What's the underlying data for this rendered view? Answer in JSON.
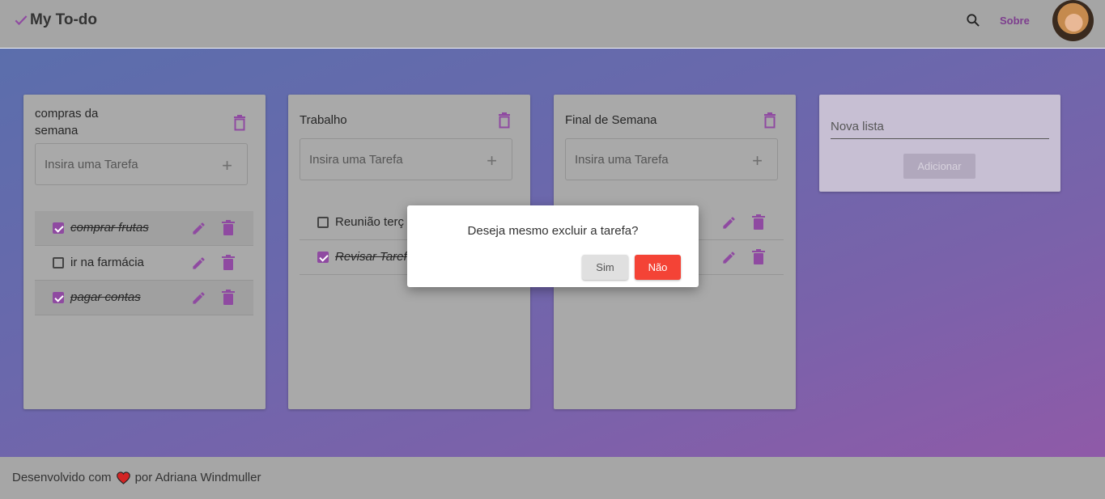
{
  "header": {
    "title": "My To-do",
    "search_icon": "search-icon",
    "sobre_label": "Sobre",
    "check_color": "#8f4aa1"
  },
  "lists": [
    {
      "title_line1": "compras da",
      "title_line2": "semana",
      "input_placeholder": "Insira uma Tarefa",
      "tasks": [
        {
          "label": "comprar frutas",
          "done": true
        },
        {
          "label": "ir na farmácia",
          "done": false
        },
        {
          "label": "pagar contas",
          "done": true
        }
      ]
    },
    {
      "title": "Trabalho",
      "input_placeholder": "Insira uma Tarefa",
      "tasks": [
        {
          "label": "Reunião terç",
          "done": false
        },
        {
          "label": "Revisar Taref",
          "done": true
        }
      ]
    },
    {
      "title": "Final de Semana",
      "input_placeholder": "Insira uma Tarefa",
      "tasks": []
    }
  ],
  "new_list": {
    "placeholder": "Nova lista",
    "add_label": "Adicionar"
  },
  "modal": {
    "message": "Deseja mesmo excluir a tarefa?",
    "yes_label": "Sim",
    "no_label": "Não"
  },
  "footer": {
    "text_before": "Desenvolvido com",
    "text_after": "por Adriana Windmuller"
  },
  "colors": {
    "accent": "#8f4aa1",
    "danger": "#f44336"
  }
}
